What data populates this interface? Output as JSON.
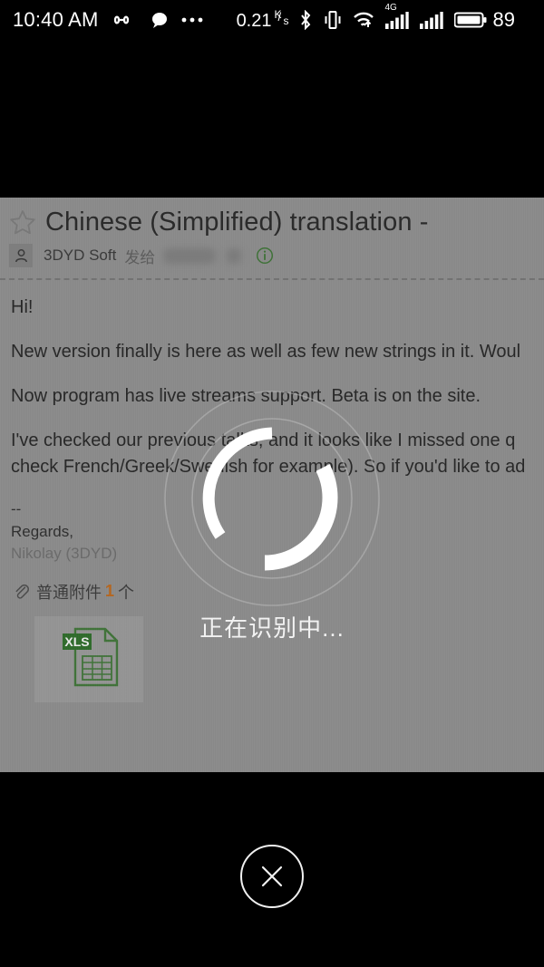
{
  "statusbar": {
    "time": "10:40 AM",
    "infinity_icon": "infinity-icon",
    "message_icon": "message-bubble-icon",
    "more_icon": "more-dots-icon",
    "data_rate": "0.21",
    "data_rate_unit_top": "K",
    "data_rate_unit_bottom": "s",
    "bluetooth_icon": "bluetooth-icon",
    "vibrate_icon": "vibrate-icon",
    "wifi_icon": "wifi-icon",
    "network_type": "4G",
    "signal1_icon": "signal-bars-icon",
    "signal2_icon": "signal-bars-icon",
    "battery_icon": "battery-icon",
    "battery_level": "89"
  },
  "mail": {
    "star_icon": "star-outline-icon",
    "title": "Chinese (Simplified) translation -",
    "avatar_icon": "person-icon",
    "sender": "3DYD Soft",
    "to_label": "发给",
    "info_icon": "info-circle-icon",
    "body": [
      "Hi!",
      "New version finally is here as well as few new strings in it. Woul",
      "Now program has live streams support. Beta is on the site.",
      "I've checked our previous talks, and it looks like I missed one q",
      "check French/Greek/Swedish for example). So if you'd like to ad"
    ],
    "signature": {
      "dashes": "--",
      "regards": "Regards,",
      "name": "Nikolay (3DYD)"
    },
    "attachment": {
      "clip_icon": "paperclip-icon",
      "label": "普通附件",
      "count": "1",
      "unit": "个",
      "file_type": "XLS",
      "file_icon": "xls-file-icon"
    }
  },
  "overlay": {
    "spinner_icon": "loading-spinner-icon",
    "status_text": "正在识别中..."
  },
  "bottombar": {
    "close_icon": "close-circle-icon",
    "close_label": "Close"
  },
  "colors": {
    "page_bg": "#8a8a8a",
    "bar_bg": "#000000",
    "accent_orange": "#b5651d",
    "accent_green": "#3f7238",
    "text_primary": "#262626"
  }
}
